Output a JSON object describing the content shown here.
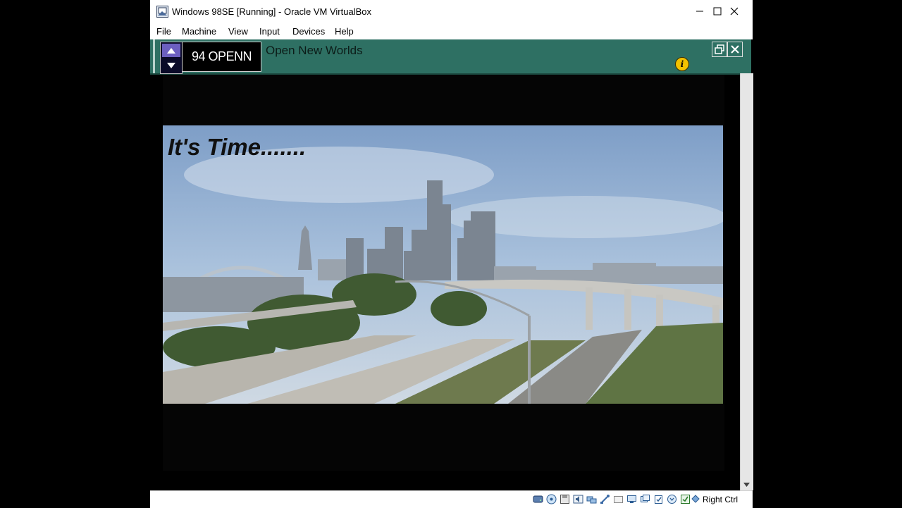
{
  "window": {
    "title": "Windows 98SE [Running] - Oracle VM VirtualBox",
    "controls": {
      "minimize": "—",
      "maximize": "☐",
      "close": "✕"
    }
  },
  "menu": {
    "items": [
      "File",
      "Machine",
      "View",
      "Input",
      "Devices",
      "Help"
    ]
  },
  "tuner": {
    "channel": "94 OPENN",
    "program_title": "Open New Worlds",
    "accent_color": "#2e7063"
  },
  "video": {
    "caption": "It's Time......."
  },
  "statusbar": {
    "icons": [
      "hard-disk-icon",
      "optical-drive-icon",
      "floppy-icon",
      "audio-icon",
      "network-icon",
      "usb-icon",
      "shared-folder-icon",
      "display-icon",
      "recording-icon",
      "clipboard-icon",
      "mouse-integration-icon",
      "cpu-icon",
      "keyboard-icon"
    ],
    "host_key": "Right Ctrl"
  }
}
